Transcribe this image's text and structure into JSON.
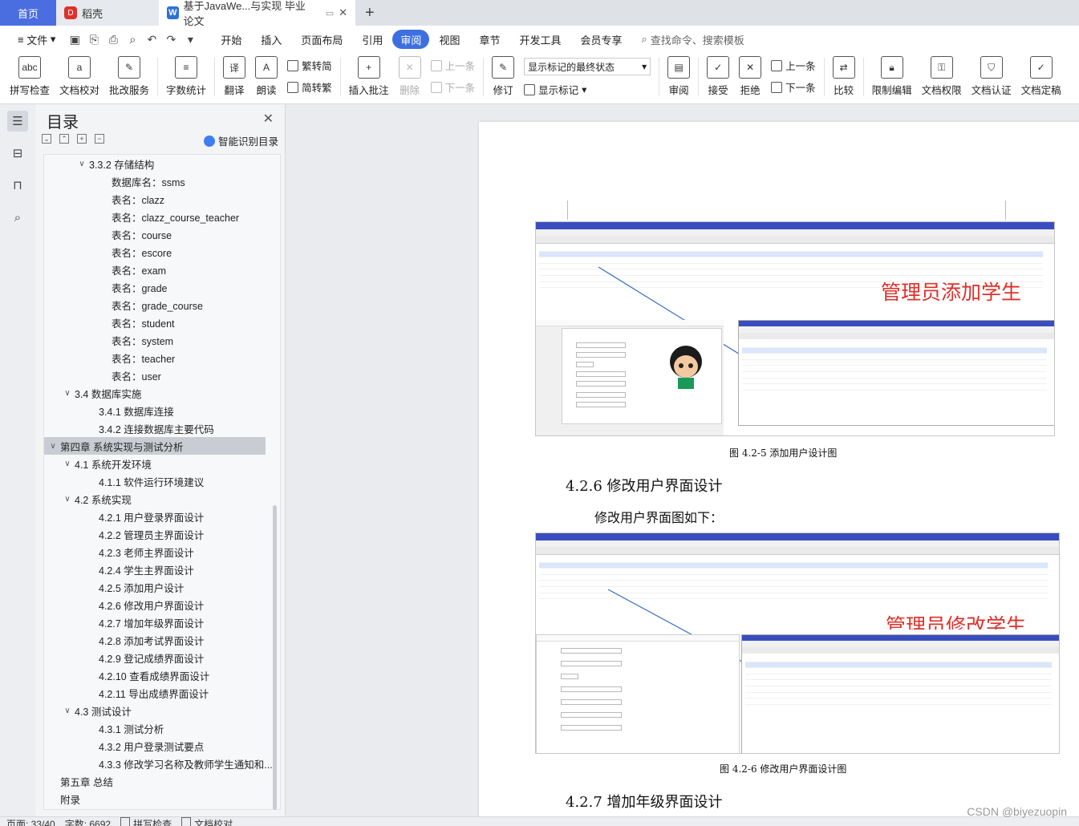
{
  "tabs": {
    "home": "首页",
    "docer": "稻壳",
    "active": "基于JavaWe...与实现 毕业论文"
  },
  "menu": {
    "file": "文件",
    "items": [
      "开始",
      "插入",
      "页面布局",
      "引用",
      "审阅",
      "视图",
      "章节",
      "开发工具",
      "会员专享"
    ],
    "active": "审阅",
    "search": "查找命令、搜索模板"
  },
  "ribbon": {
    "spell": "拼写检查",
    "proof": "文档校对",
    "annot_service": "批改服务",
    "wordcount": "字数统计",
    "translate": "翻译",
    "read": "朗读",
    "to_trad": "繁转简",
    "to_simp": "简转繁",
    "insert_comment": "插入批注",
    "delete": "删除",
    "prev_comment": "上一条",
    "next_comment": "下一条",
    "revise": "修订",
    "markup_dropdown": "显示标记的最终状态",
    "show_markup": "显示标记",
    "review": "审阅",
    "accept": "接受",
    "reject": "拒绝",
    "prev_change": "上一条",
    "next_change": "下一条",
    "compare": "比较",
    "restrict": "限制编辑",
    "permission": "文档权限",
    "certify": "文档认证",
    "finalize": "文档定稿"
  },
  "toc": {
    "title": "目录",
    "smart": "智能识别目录",
    "items": [
      {
        "text": "3.3.2 存储结构",
        "level": "l3a",
        "arrow": "v"
      },
      {
        "text": "数据库名：ssms",
        "level": "l4"
      },
      {
        "text": "表名：clazz",
        "level": "l4"
      },
      {
        "text": "表名：clazz_course_teacher",
        "level": "l4"
      },
      {
        "text": "表名：course",
        "level": "l4"
      },
      {
        "text": "表名：escore",
        "level": "l4"
      },
      {
        "text": "表名：exam",
        "level": "l4"
      },
      {
        "text": "表名：grade",
        "level": "l4"
      },
      {
        "text": "表名：grade_course",
        "level": "l4"
      },
      {
        "text": "表名：student",
        "level": "l4"
      },
      {
        "text": "表名：system",
        "level": "l4"
      },
      {
        "text": "表名：teacher",
        "level": "l4"
      },
      {
        "text": "表名：user",
        "level": "l4"
      },
      {
        "text": "3.4 数据库实施",
        "level": "l2",
        "arrow": "v"
      },
      {
        "text": "3.4.1 数据库连接",
        "level": "l3"
      },
      {
        "text": "3.4.2 连接数据库主要代码",
        "level": "l3"
      },
      {
        "text": "第四章  系统实现与测试分析",
        "level": "l1",
        "arrow": "v",
        "selected": true
      },
      {
        "text": "4.1 系统开发环境",
        "level": "l2",
        "arrow": "v"
      },
      {
        "text": "4.1.1 软件运行环境建议",
        "level": "l3"
      },
      {
        "text": "4.2 系统实现",
        "level": "l2",
        "arrow": "v"
      },
      {
        "text": "4.2.1 用户登录界面设计",
        "level": "l3"
      },
      {
        "text": "4.2.2 管理员主界面设计",
        "level": "l3"
      },
      {
        "text": "4.2.3 老师主界面设计",
        "level": "l3"
      },
      {
        "text": "4.2.4 学生主界面设计",
        "level": "l3"
      },
      {
        "text": "4.2.5 添加用户设计",
        "level": "l3"
      },
      {
        "text": "4.2.6 修改用户界面设计",
        "level": "l3"
      },
      {
        "text": "4.2.7 增加年级界面设计",
        "level": "l3"
      },
      {
        "text": "4.2.8 添加考试界面设计",
        "level": "l3"
      },
      {
        "text": "4.2.9 登记成绩界面设计",
        "level": "l3"
      },
      {
        "text": "4.2.10 查看成绩界面设计",
        "level": "l3"
      },
      {
        "text": "4.2.11 导出成绩界面设计",
        "level": "l3"
      },
      {
        "text": "4.3 测试设计",
        "level": "l2",
        "arrow": "v"
      },
      {
        "text": "4.3.1 测试分析",
        "level": "l3"
      },
      {
        "text": "4.3.2 用户登录测试要点",
        "level": "l3"
      },
      {
        "text": "4.3.3 修改学习名称及教师学生通知和...",
        "level": "l3"
      },
      {
        "text": "第五章  总结",
        "level": "l1"
      },
      {
        "text": "附录",
        "level": "l1"
      }
    ]
  },
  "doc": {
    "fig1_overlay": "管理员添加学生",
    "fig1_caption": "图 4.2-5 添加用户设计图",
    "h_426": "4.2.6 修改用户界面设计",
    "para_426": "修改用户界面图如下：",
    "fig2_overlay": "管理员修改学生",
    "fig2_caption": "图 4.2-6 修改用户界面设计图",
    "h_427": "4.2.7 增加年级界面设计"
  },
  "status": {
    "page": "页面: 33/40",
    "words": "字数: 6692",
    "spell": "拼写检查",
    "proof": "文档校对"
  },
  "watermark": "CSDN @biyezuopin",
  "colors": {
    "accent": "#3d6fe0",
    "overlay_red": "#e0302a",
    "nav_blue": "#3a4dbf"
  }
}
